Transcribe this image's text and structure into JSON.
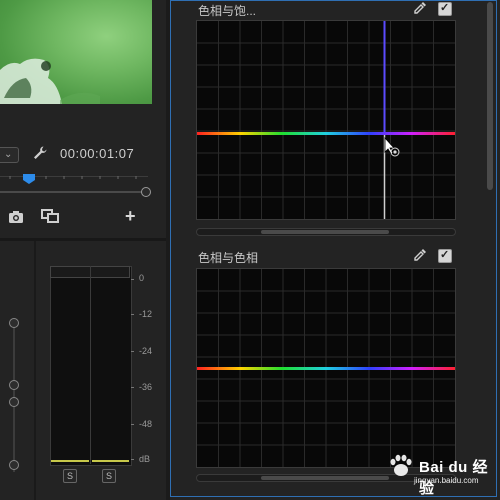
{
  "monitor": {
    "timecode": "00:00:01:07",
    "playhead_fraction": 0.19
  },
  "mixer": {
    "db_labels": [
      "0",
      "-12",
      "-24",
      "-36",
      "-48",
      "dB"
    ],
    "solo_labels": [
      "S",
      "S"
    ]
  },
  "lumetri": {
    "sections": [
      {
        "title": "色相与饱...",
        "enabled": true
      },
      {
        "title": "色相与色相",
        "enabled": true
      }
    ]
  },
  "watermark": {
    "text": "Bai du 经验",
    "sub": "jingyan.baidu.com"
  },
  "colors": {
    "panel_border": "#2f6fb3",
    "meter_level": "#c7c84a",
    "vertical_hue_line": "#5b4bff"
  }
}
